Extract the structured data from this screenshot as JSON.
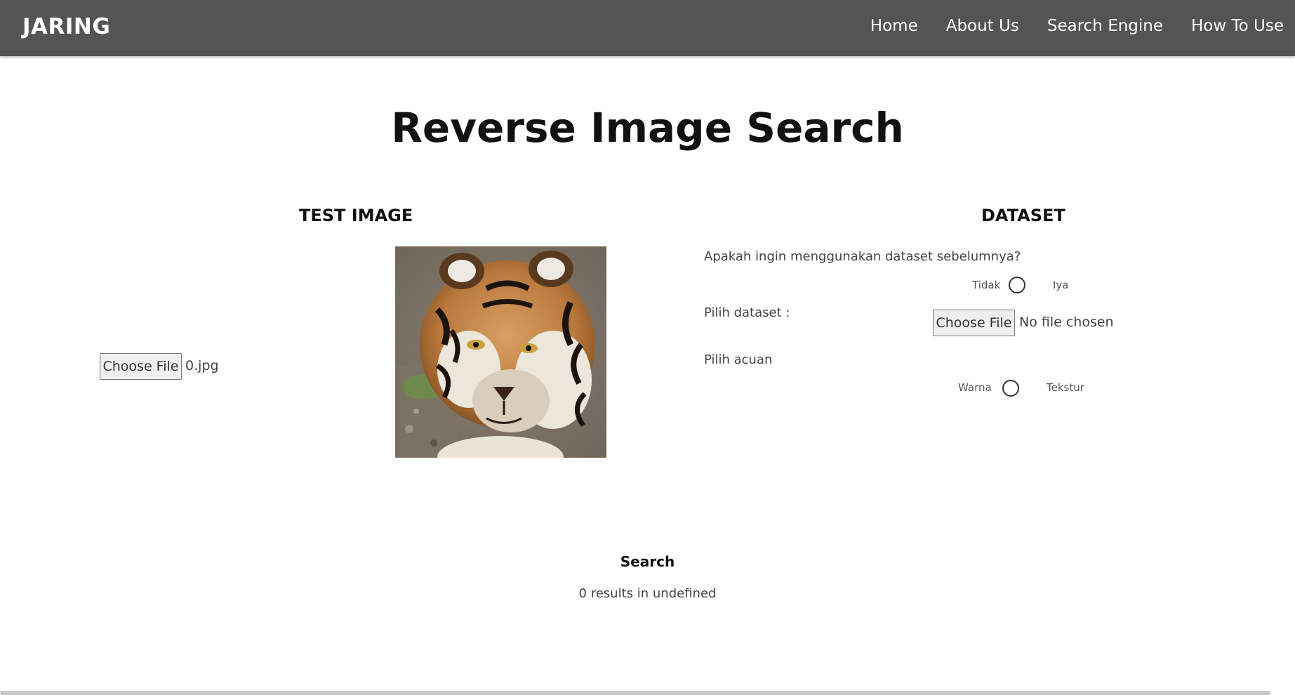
{
  "navbar": {
    "brand": "JARING",
    "links": [
      "Home",
      "About Us",
      "Search Engine",
      "How To Use"
    ]
  },
  "page": {
    "title": "Reverse Image Search"
  },
  "test_image": {
    "heading": "TEST IMAGE",
    "file_button": "Choose File",
    "file_name": "0.jpg",
    "preview_icon": "tiger-photo"
  },
  "dataset": {
    "heading": "DATASET",
    "question": "Apakah ingin menggunakan dataset sebelumnya?",
    "option_no": "Tidak",
    "option_yes": "Iya",
    "choose_label": "Pilih dataset :",
    "file_button": "Choose File",
    "file_status": "No file chosen",
    "reference_label": "Pilih acuan",
    "option_color": "Warna",
    "option_texture": "Tekstur"
  },
  "search": {
    "button": "Search",
    "results": "0 results in undefined"
  },
  "colors": {
    "navbar": "#545454",
    "text": "#111111"
  }
}
